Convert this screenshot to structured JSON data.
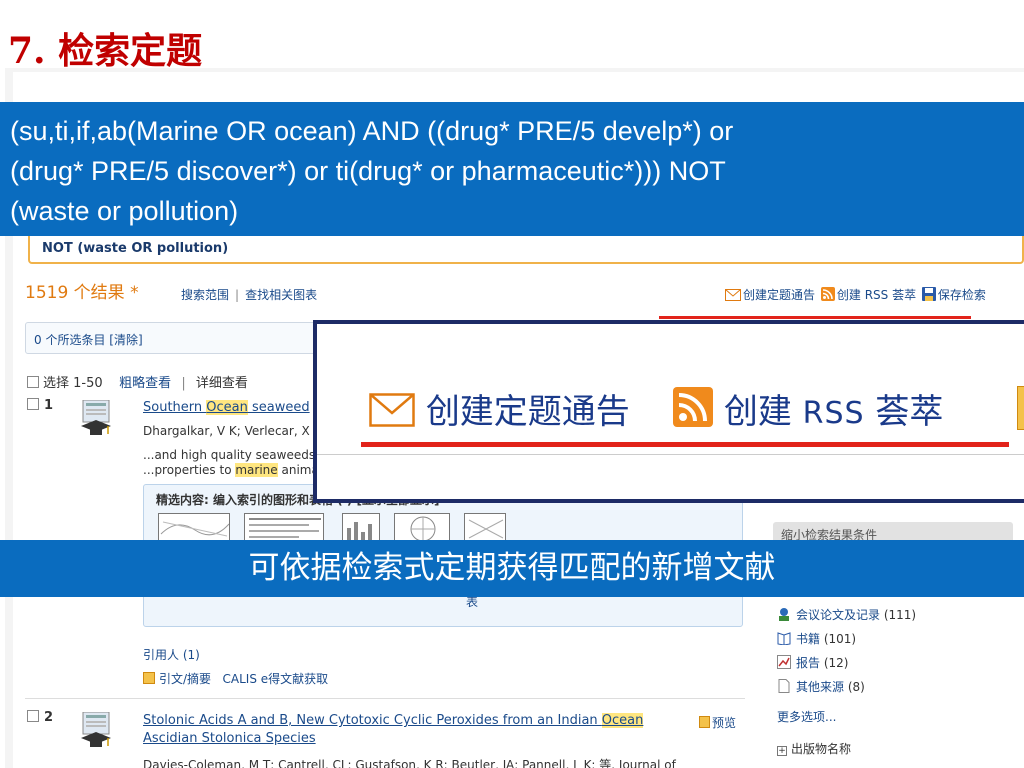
{
  "slide": {
    "title": "7.   检索定题"
  },
  "query_banner": {
    "line1": "(su,ti,if,ab(Marine OR ocean) AND ((drug* PRE/5 develp*) or",
    "line2": "(drug* PRE/5 discover*) or ti(drug* or pharmaceutic*))) NOT",
    "line3": "(waste or pollution)"
  },
  "query_box": {
    "tail": "NOT (waste OR pollution)"
  },
  "results": {
    "count": "1519 个结果 *",
    "search_scope": "搜索范围",
    "find_related": "查找相关图表",
    "create_alert": "创建定题通告",
    "create_rss": "创建",
    "rss_label": "RSS 荟萃",
    "save_search": "保存检索",
    "selected_items": "0 个所选条目 [清除]",
    "select_range": "选择 1-50",
    "brief_view": "粗略查看",
    "detail_view": "详细查看"
  },
  "records": [
    {
      "num": "1",
      "title_pre": "Southern ",
      "title_hl": "Ocean",
      "title_post": " seaweed",
      "authors": "Dhargalkar, V K; Verlecar, X",
      "snippet1": "...and high quality seaweeds.",
      "snippet2_pre": "...properties to ",
      "snippet2_hl": "marine",
      "snippet2_post": " anima",
      "figures_title": "精选内容: 编入索引的图形和表格 (   ) [显示全部显示]",
      "figures_link": "表",
      "cited_by": "引用人 (1)",
      "abstract": "引文/摘要",
      "calis": "CALIS e得文献获取"
    },
    {
      "num": "2",
      "title_line1_pre": "Stolonic Acids A and B, New Cytotoxic Cyclic Peroxides from an Indian ",
      "title_line1_hl": "Ocean",
      "title_line2": "Ascidian Stolonica Species",
      "authors": "Davies-Coleman, M T; Cantrell, CL; Gustafson, K R; Beutler, JA; Pannell, L K; 等. Journal of",
      "preview": "预览"
    }
  ],
  "refine": {
    "header": "缩小检索结果条件",
    "items": [
      {
        "label": "会议论文及记录",
        "count": "(111)"
      },
      {
        "label": "书籍",
        "count": "(101)"
      },
      {
        "label": "报告",
        "count": "(12)"
      },
      {
        "label": "其他来源",
        "count": "(8)"
      }
    ],
    "more": "更多选项...",
    "publication": "出版物名称"
  },
  "zoom": {
    "alert": "创建定题通告",
    "rss_prefix": "创建",
    "rss_word": "RSS",
    "rss_suffix": "荟萃"
  },
  "caption": "可依据检索式定期获得匹配的新增文献",
  "colors": {
    "title_red": "#c00000",
    "banner_blue": "#0a6cbf",
    "link_blue": "#1a4a8a",
    "count_orange": "#e07a10",
    "highlight": "#ffe680",
    "red_line": "#e2231a"
  }
}
